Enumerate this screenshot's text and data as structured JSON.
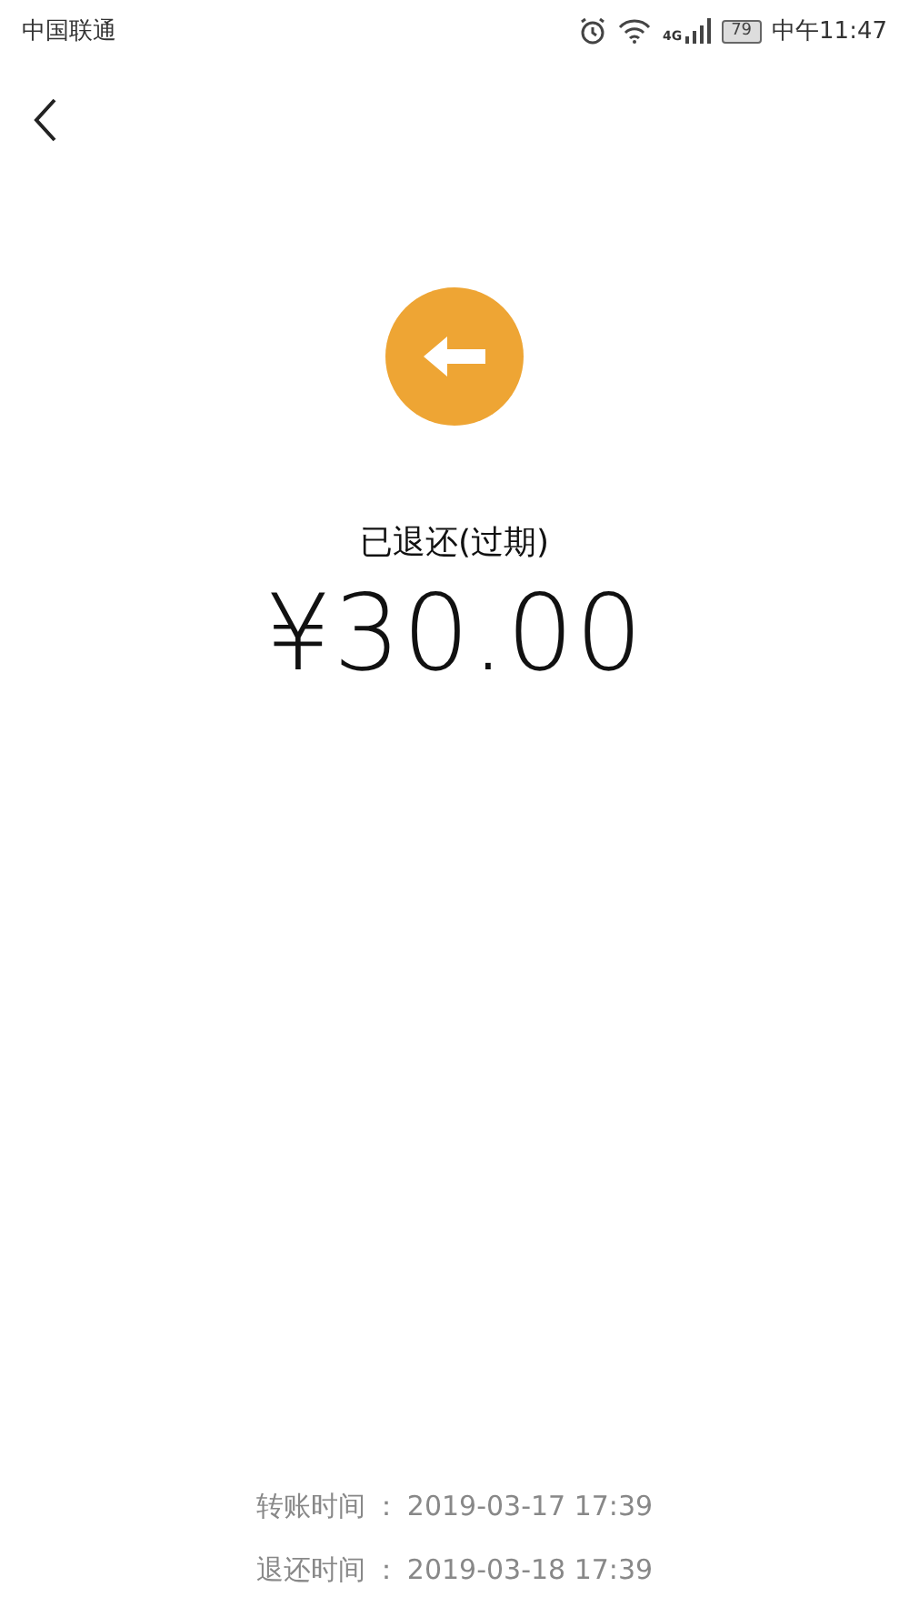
{
  "status_bar": {
    "carrier": "中国联通",
    "network": "4G",
    "battery": "79",
    "time": "中午11:47"
  },
  "status": "已退还(过期)",
  "amount": "¥30.00",
  "details": [
    {
      "label": "转账时间",
      "separator": "：",
      "value": "2019-03-17 17:39"
    },
    {
      "label": "退还时间",
      "separator": "：",
      "value": "2019-03-18 17:39"
    }
  ]
}
